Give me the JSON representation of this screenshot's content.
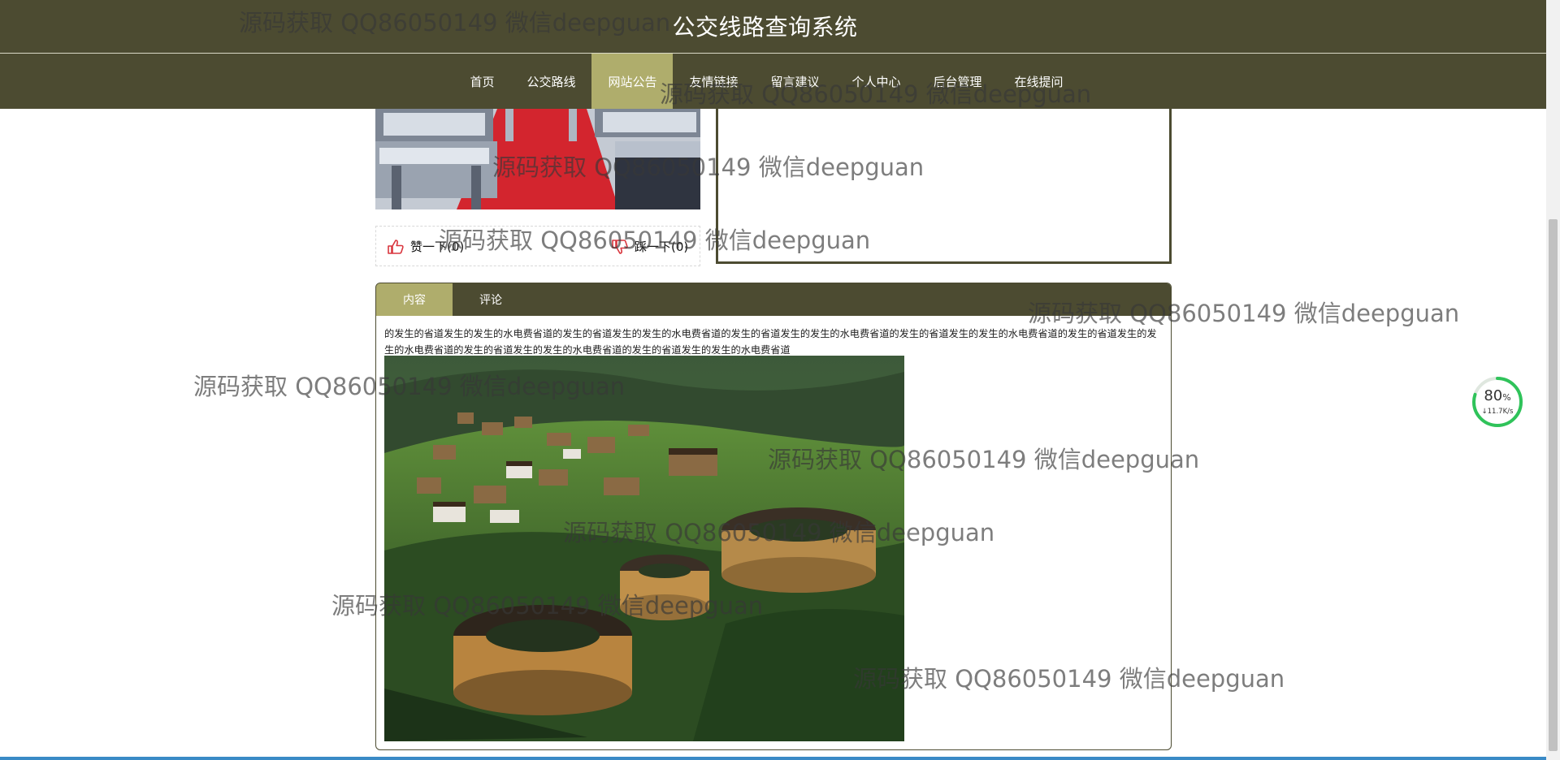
{
  "site": {
    "title": "公交线路查询系统"
  },
  "nav": {
    "items": [
      {
        "label": "首页",
        "active": false
      },
      {
        "label": "公交路线",
        "active": false
      },
      {
        "label": "网站公告",
        "active": true
      },
      {
        "label": "友情链接",
        "active": false
      },
      {
        "label": "留言建议",
        "active": false
      },
      {
        "label": "个人中心",
        "active": false
      },
      {
        "label": "后台管理",
        "active": false
      },
      {
        "label": "在线提问",
        "active": false
      }
    ]
  },
  "vote": {
    "up_label": "赞一下(0)",
    "down_label": "踩一下(0)"
  },
  "tabs": [
    {
      "label": "内容",
      "active": true
    },
    {
      "label": "评论",
      "active": false
    }
  ],
  "content": {
    "text": "的发生的省道发生的发生的水电费省道的发生的省道发生的发生的水电费省道的发生的省道发生的发生的水电费省道的发生的省道发生的发生的水电费省道的发生的省道发生的发生的水电费省道的发生的省道发生的发生的水电费省道的发生的省道发生的发生的水电费省道"
  },
  "speed_widget": {
    "percent": "80",
    "percent_unit": "%",
    "rate": "↓11.7K/s"
  },
  "watermark": {
    "text": "源码获取 QQ86050149 微信deepguan"
  },
  "colors": {
    "primary": "#4c4b31",
    "accent": "#afad6c",
    "vote_icon": "#d9363e"
  },
  "icons": {
    "vote_up": "thumb-up-icon",
    "vote_down": "thumb-down-icon"
  }
}
